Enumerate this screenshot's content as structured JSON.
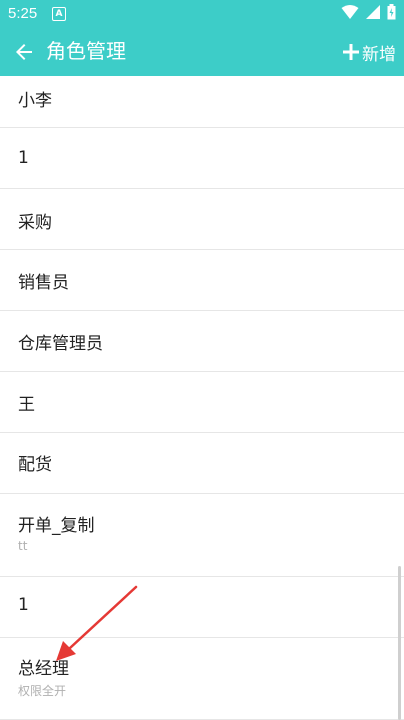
{
  "status_bar": {
    "time": "5:25",
    "notification_icon": "A"
  },
  "app_bar": {
    "title": "角色管理",
    "add_label": "新增"
  },
  "roles": [
    {
      "name": "小李",
      "desc": ""
    },
    {
      "name": "1",
      "desc": ""
    },
    {
      "name": "采购",
      "desc": ""
    },
    {
      "name": "销售员",
      "desc": ""
    },
    {
      "name": "仓库管理员",
      "desc": ""
    },
    {
      "name": "王",
      "desc": ""
    },
    {
      "name": "配货",
      "desc": ""
    },
    {
      "name": "开单_复制",
      "desc": "tt"
    },
    {
      "name": "1",
      "desc": ""
    },
    {
      "name": "总经理",
      "desc": "权限全开"
    }
  ],
  "colors": {
    "accent": "#3dcdc8",
    "annotation_arrow": "#e53935"
  },
  "icons": [
    "back-arrow-icon",
    "plus-icon",
    "wifi-icon",
    "signal-icon",
    "battery-icon"
  ]
}
